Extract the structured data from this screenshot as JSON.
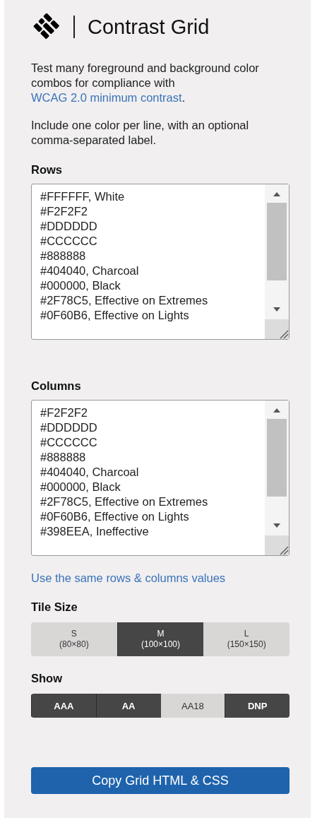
{
  "header": {
    "title": "Contrast Grid"
  },
  "intro": {
    "text": "Test many foreground and background color combos for compliance with",
    "link": "WCAG 2.0 minimum contrast",
    "after": "."
  },
  "hint": "Include one color per line, with an optional comma-separated label.",
  "rows": {
    "label": "Rows",
    "lines": [
      "#FFFFFF, White",
      "#F2F2F2",
      "#DDDDDD",
      "#CCCCCC",
      "#888888",
      "#404040, Charcoal",
      "#000000, Black",
      "#2F78C5, Effective on Extremes",
      "#0F60B6, Effective on Lights"
    ]
  },
  "columns": {
    "label": "Columns",
    "lines": [
      "#F2F2F2",
      "#DDDDDD",
      "#CCCCCC",
      "#888888",
      "#404040, Charcoal",
      "#000000, Black",
      "#2F78C5, Effective on Extremes",
      "#0F60B6, Effective on Lights",
      "#398EEA, Ineffective"
    ]
  },
  "same_values_link": "Use the same rows & columns values",
  "tile_size": {
    "label": "Tile Size",
    "options": [
      {
        "name": "S",
        "size": "(80×80)",
        "selected": false
      },
      {
        "name": "M",
        "size": "(100×100)",
        "selected": true
      },
      {
        "name": "L",
        "size": "(150×150)",
        "selected": false
      }
    ]
  },
  "show": {
    "label": "Show",
    "options": [
      {
        "label": "AAA",
        "on": true
      },
      {
        "label": "AA",
        "on": true
      },
      {
        "label": "AA18",
        "on": false
      },
      {
        "label": "DNP",
        "on": true
      }
    ]
  },
  "copy_button": "Copy Grid HTML & CSS"
}
